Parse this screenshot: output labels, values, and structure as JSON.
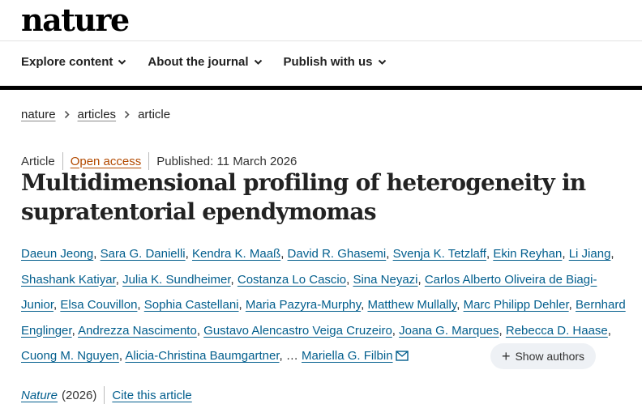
{
  "site": {
    "logo": "nature"
  },
  "nav": [
    {
      "label": "Explore content"
    },
    {
      "label": "About the journal"
    },
    {
      "label": "Publish with us"
    }
  ],
  "breadcrumb": [
    "nature",
    "articles",
    "article"
  ],
  "article": {
    "type": "Article",
    "access": "Open access",
    "published": "Published: 11 March 2026",
    "title": "Multidimensional profiling of heterogeneity in supratentorial ependymomas",
    "authors": [
      "Daeun Jeong",
      "Sara G. Danielli",
      "Kendra K. Maaß",
      "David R. Ghasemi",
      "Svenja K. Tetzlaff",
      "Ekin Reyhan",
      "Li Jiang",
      "Shashank Katiyar",
      "Julia K. Sundheimer",
      "Costanza Lo Cascio",
      "Sina Neyazi",
      "Carlos Alberto Oliveira de Biagi-Junior",
      "Elsa Couvillon",
      "Sophia Castellani",
      "Maria Pazyra-Murphy",
      "Matthew Mullally",
      "Marc Philipp Dehler",
      "Bernhard Englinger",
      "Andrezza Nascimento",
      "Gustavo Alencastro Veiga Cruzeiro",
      "Joana G. Marques",
      "Rebecca D. Haase",
      "Cuong M. Nguyen",
      "Alicia-Christina Baumgartner"
    ],
    "ellipsis": "…",
    "last_author": "Mariella G. Filbin",
    "show_authors": "Show authors",
    "journal": "Nature",
    "year": "(2026)",
    "cite": "Cite this article"
  },
  "colors": {
    "link": "#025e8d",
    "open_access": "#b34a00"
  },
  "icons": [
    "chevron-down-icon",
    "chevron-right-icon",
    "mail-icon",
    "plus-icon"
  ]
}
